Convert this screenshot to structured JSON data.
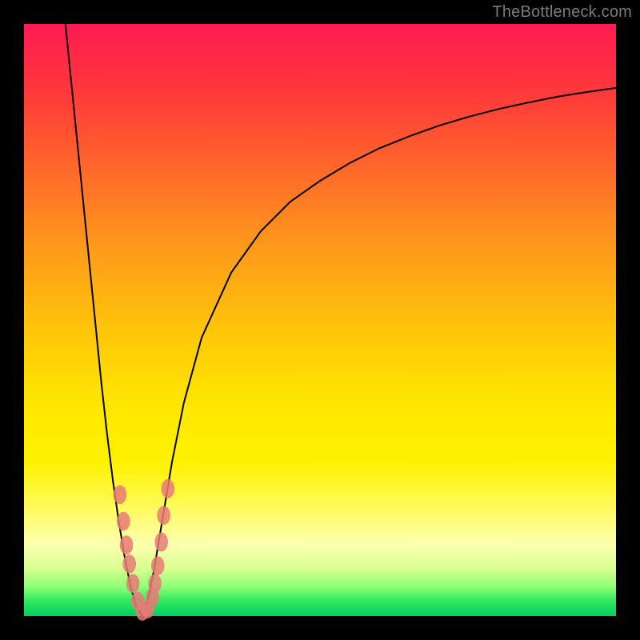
{
  "watermark": "TheBottleneck.com",
  "chart_data": {
    "type": "line",
    "title": "",
    "xlabel": "",
    "ylabel": "",
    "xlim": [
      0,
      100
    ],
    "ylim": [
      0,
      100
    ],
    "series": [
      {
        "name": "left-curve",
        "x": [
          7,
          8,
          9,
          10,
          11,
          12,
          13,
          14,
          15,
          16,
          17,
          18,
          19,
          20
        ],
        "y": [
          100,
          90,
          80,
          70,
          60,
          50,
          40,
          31,
          23,
          16,
          10,
          5,
          1.5,
          0
        ]
      },
      {
        "name": "right-curve",
        "x": [
          20,
          21,
          22,
          23,
          24,
          25,
          27,
          30,
          35,
          40,
          45,
          50,
          55,
          60,
          65,
          70,
          75,
          80,
          85,
          90,
          95,
          100
        ],
        "y": [
          0,
          3,
          8,
          14,
          20,
          26,
          36,
          47,
          58,
          65,
          70,
          73.5,
          76.5,
          79,
          81,
          82.8,
          84.3,
          85.6,
          86.7,
          87.7,
          88.5,
          89.2
        ]
      }
    ],
    "points": [
      {
        "name": "p1",
        "x": 16.2,
        "y": 20.5
      },
      {
        "name": "p2",
        "x": 16.8,
        "y": 16.0
      },
      {
        "name": "p3",
        "x": 17.3,
        "y": 12.0
      },
      {
        "name": "p4",
        "x": 17.8,
        "y": 8.8
      },
      {
        "name": "p5",
        "x": 18.4,
        "y": 5.5
      },
      {
        "name": "p6",
        "x": 19.2,
        "y": 2.5
      },
      {
        "name": "p7",
        "x": 20.0,
        "y": 0.8
      },
      {
        "name": "p8",
        "x": 20.9,
        "y": 1.2
      },
      {
        "name": "p9",
        "x": 21.7,
        "y": 3.2
      },
      {
        "name": "p10",
        "x": 22.6,
        "y": 8.5
      },
      {
        "name": "p11",
        "x": 23.2,
        "y": 12.5
      },
      {
        "name": "p12",
        "x": 23.6,
        "y": 17.0
      },
      {
        "name": "p13",
        "x": 24.3,
        "y": 21.5
      },
      {
        "name": "p14",
        "x": 22.1,
        "y": 5.5
      }
    ],
    "point_radius_y": 1.6,
    "gradient_stops": [
      {
        "pos": 0,
        "color": "#ff1a52"
      },
      {
        "pos": 12,
        "color": "#ff3a3a"
      },
      {
        "pos": 25,
        "color": "#ff6a2a"
      },
      {
        "pos": 38,
        "color": "#ff9a1a"
      },
      {
        "pos": 52,
        "color": "#ffc60a"
      },
      {
        "pos": 64,
        "color": "#ffe600"
      },
      {
        "pos": 74,
        "color": "#fff200"
      },
      {
        "pos": 82,
        "color": "#fffb60"
      },
      {
        "pos": 88,
        "color": "#fdffb0"
      },
      {
        "pos": 92,
        "color": "#d8ff90"
      },
      {
        "pos": 95,
        "color": "#90ff78"
      },
      {
        "pos": 97.5,
        "color": "#30e860"
      },
      {
        "pos": 100,
        "color": "#00d060"
      }
    ]
  }
}
